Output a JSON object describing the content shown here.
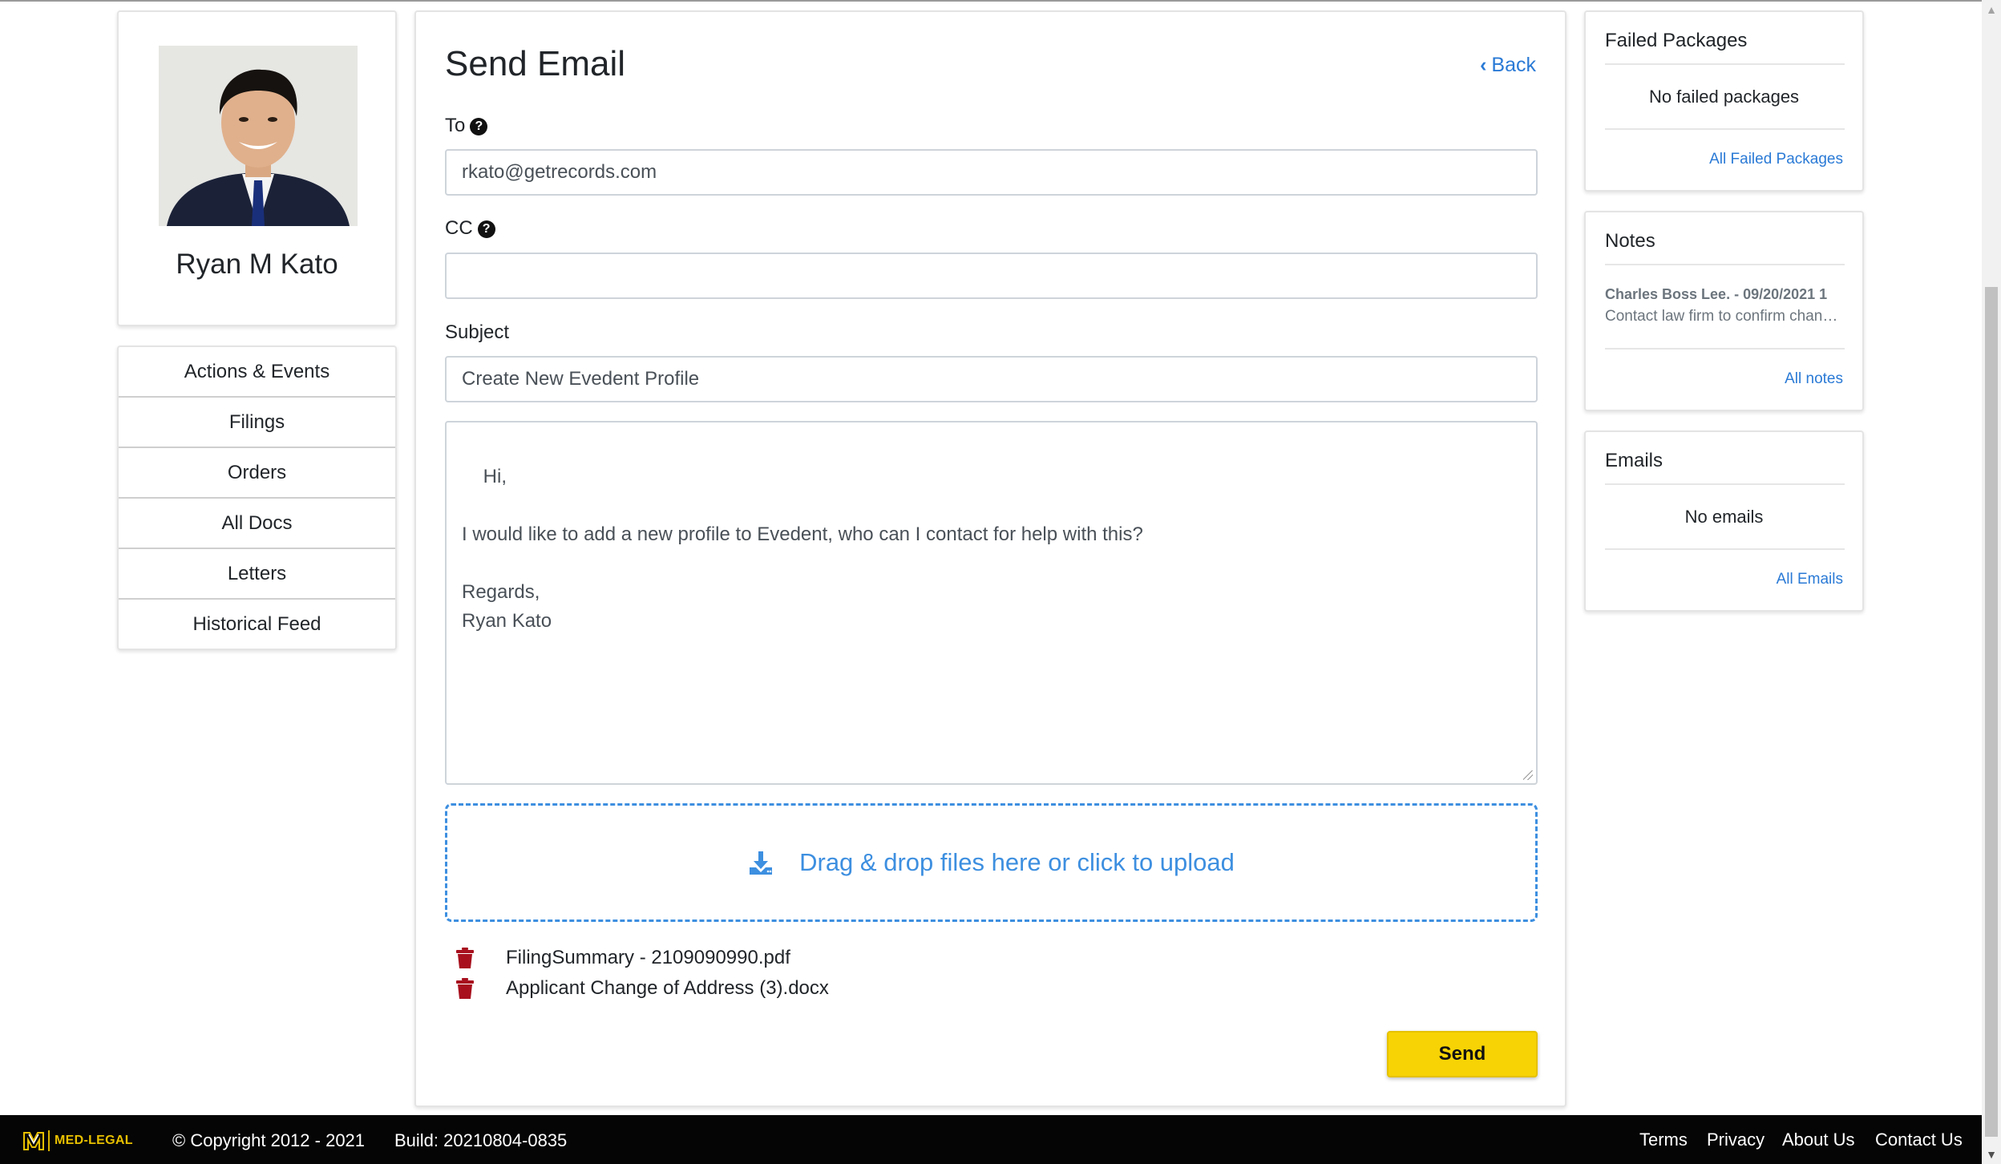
{
  "profile": {
    "name": "Ryan M Kato"
  },
  "nav": {
    "items": [
      {
        "label": "Actions & Events"
      },
      {
        "label": "Filings"
      },
      {
        "label": "Orders"
      },
      {
        "label": "All Docs"
      },
      {
        "label": "Letters"
      },
      {
        "label": "Historical Feed"
      }
    ]
  },
  "email": {
    "title": "Send Email",
    "back_label": "Back",
    "to_label": "To",
    "to_value": "rkato@getrecords.com",
    "cc_label": "CC",
    "cc_value": "",
    "subject_label": "Subject",
    "subject_value": "Create New Evedent Profile",
    "body": "Hi,\n\nI would like to add a new profile to Evedent, who can I contact for help with this?\n\nRegards,\nRyan Kato",
    "dropzone_text": "Drag & drop files here or click to upload",
    "attachments": [
      {
        "name": "FilingSummary - 2109090990.pdf"
      },
      {
        "name": "Applicant Change of Address (3).docx"
      }
    ],
    "send_label": "Send"
  },
  "failed_packages": {
    "title": "Failed Packages",
    "empty_text": "No failed packages",
    "link": "All Failed Packages"
  },
  "notes": {
    "title": "Notes",
    "author": "Charles Boss Lee. - 09/20/2021 1",
    "text": "Contact law firm to confirm change of address",
    "link": "All notes"
  },
  "emails": {
    "title": "Emails",
    "empty_text": "No emails",
    "link": "All Emails"
  },
  "footer": {
    "logo_text": "MED-LEGAL",
    "copyright": "© Copyright 2012 - 2021",
    "build": "Build: 20210804-0835",
    "links": [
      "Terms",
      "Privacy",
      "About Us",
      "Contact Us"
    ]
  },
  "colors": {
    "accent": "#2a7ad6",
    "send_button": "#f7d305",
    "dropzone": "#3d8fe0",
    "trash": "#a8101e",
    "footer_bg": "#050505",
    "logo": "#e8c000"
  }
}
